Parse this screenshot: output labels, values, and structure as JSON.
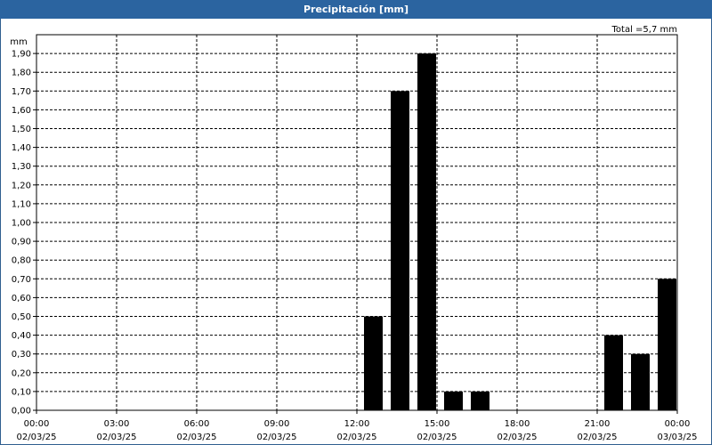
{
  "window": {
    "title": "Precipitación [mm]"
  },
  "chart_data": {
    "type": "bar",
    "title": "Precipitación [mm]",
    "ylabel": "mm",
    "xlabel": "",
    "total_label": "Total =5,7 mm",
    "ylim": [
      0,
      2.0
    ],
    "y_ticks": [
      "0,00",
      "0,10",
      "0,20",
      "0,30",
      "0,40",
      "0,50",
      "0,60",
      "0,70",
      "0,80",
      "0,90",
      "1,00",
      "1,10",
      "1,20",
      "1,30",
      "1,40",
      "1,50",
      "1,60",
      "1,70",
      "1,80",
      "1,90"
    ],
    "x_range_hours": [
      0,
      24
    ],
    "x_ticks": [
      {
        "time": "00:00",
        "date": "02/03/25"
      },
      {
        "time": "03:00",
        "date": "02/03/25"
      },
      {
        "time": "06:00",
        "date": "02/03/25"
      },
      {
        "time": "09:00",
        "date": "02/03/25"
      },
      {
        "time": "12:00",
        "date": "02/03/25"
      },
      {
        "time": "15:00",
        "date": "02/03/25"
      },
      {
        "time": "18:00",
        "date": "02/03/25"
      },
      {
        "time": "21:00",
        "date": "02/03/25"
      },
      {
        "time": "00:00",
        "date": "03/03/25"
      }
    ],
    "bars": [
      {
        "time": "13:00",
        "value": 0.5
      },
      {
        "time": "14:00",
        "value": 1.7
      },
      {
        "time": "15:00",
        "value": 1.9
      },
      {
        "time": "16:00",
        "value": 0.1
      },
      {
        "time": "17:00",
        "value": 0.1
      },
      {
        "time": "22:00",
        "value": 0.4
      },
      {
        "time": "23:00",
        "value": 0.3
      },
      {
        "time": "00:00",
        "value": 0.7
      }
    ],
    "bar_color": "#000000",
    "grid": true
  }
}
